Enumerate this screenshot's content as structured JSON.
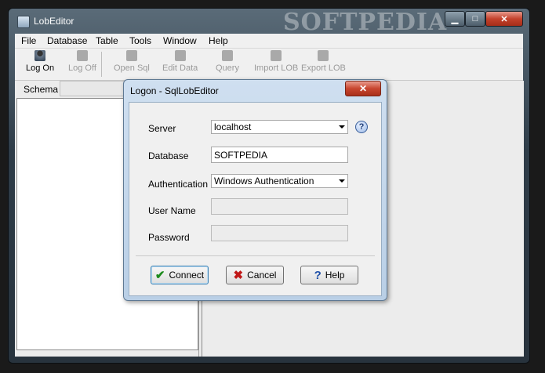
{
  "window": {
    "title": "LobEditor",
    "watermark": "SOFTPEDIA"
  },
  "menu": [
    "File",
    "Database",
    "Table",
    "Tools",
    "Window",
    "Help"
  ],
  "toolbar": {
    "log_on": "Log On",
    "log_off": "Log Off",
    "open_sql": "Open Sql",
    "edit_data": "Edit Data",
    "query": "Query",
    "import_lob": "Import LOB",
    "export_lob": "Export LOB"
  },
  "schema": {
    "label": "Schema"
  },
  "dialog": {
    "title": "Logon - SqlLobEditor",
    "server_label": "Server",
    "server_value": "localhost",
    "database_label": "Database",
    "database_value": "SOFTPEDIA",
    "authentication_label": "Authentication",
    "authentication_value": "Windows Authentication",
    "username_label": "User Name",
    "username_value": "",
    "password_label": "Password",
    "password_value": "",
    "connect_label": "Connect",
    "cancel_label": "Cancel",
    "help_label": "Help"
  },
  "colors": {
    "accent": "#3c7fb1",
    "close": "#c8462f",
    "connect_icon": "#1c8a1c",
    "cancel_icon": "#c01818"
  }
}
